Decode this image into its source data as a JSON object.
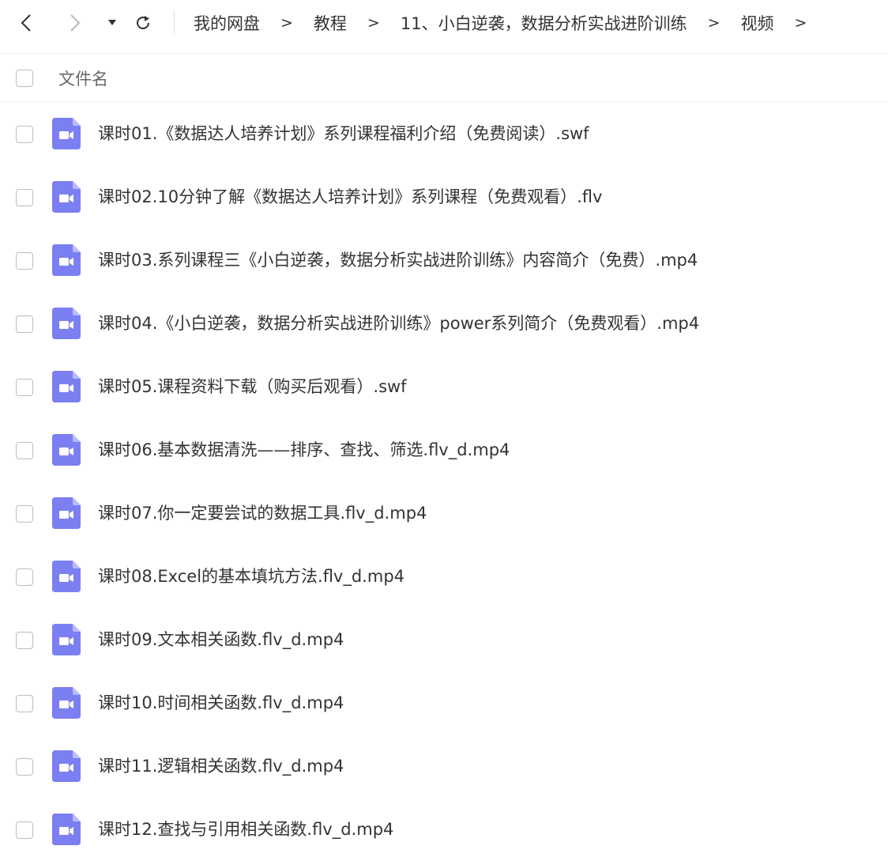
{
  "toolbar": {
    "back_icon": "chevron-left-icon",
    "forward_icon": "chevron-right-icon",
    "dropdown_icon": "caret-down-icon",
    "refresh_icon": "refresh-icon"
  },
  "breadcrumb": {
    "items": [
      "我的网盘",
      "教程",
      "11、小白逆袭，数据分析实战进阶训练",
      "视频"
    ],
    "separator": ">"
  },
  "list_header": {
    "name_label": "文件名"
  },
  "colors": {
    "file_icon": "#7b7ff2",
    "text": "#333333",
    "header_text": "#666666",
    "checkbox_border": "#bdbdbd"
  },
  "files": [
    {
      "name": "课时01.《数据达人培养计划》系列课程福利介绍（免费阅读）.swf",
      "icon": "video-file-icon"
    },
    {
      "name": "课时02.10分钟了解《数据达人培养计划》系列课程（免费观看）.flv",
      "icon": "video-file-icon"
    },
    {
      "name": "课时03.系列课程三《小白逆袭，数据分析实战进阶训练》内容简介（免费）.mp4",
      "icon": "video-file-icon"
    },
    {
      "name": "课时04.《小白逆袭，数据分析实战进阶训练》power系列简介（免费观看）.mp4",
      "icon": "video-file-icon"
    },
    {
      "name": "课时05.课程资料下载（购买后观看）.swf",
      "icon": "video-file-icon"
    },
    {
      "name": "课时06.基本数据清洗——排序、查找、筛选.flv_d.mp4",
      "icon": "video-file-icon"
    },
    {
      "name": "课时07.你一定要尝试的数据工具.flv_d.mp4",
      "icon": "video-file-icon"
    },
    {
      "name": "课时08.Excel的基本填坑方法.flv_d.mp4",
      "icon": "video-file-icon"
    },
    {
      "name": "课时09.文本相关函数.flv_d.mp4",
      "icon": "video-file-icon"
    },
    {
      "name": "课时10.时间相关函数.flv_d.mp4",
      "icon": "video-file-icon"
    },
    {
      "name": "课时11.逻辑相关函数.flv_d.mp4",
      "icon": "video-file-icon"
    },
    {
      "name": "课时12.查找与引用相关函数.flv_d.mp4",
      "icon": "video-file-icon"
    }
  ]
}
